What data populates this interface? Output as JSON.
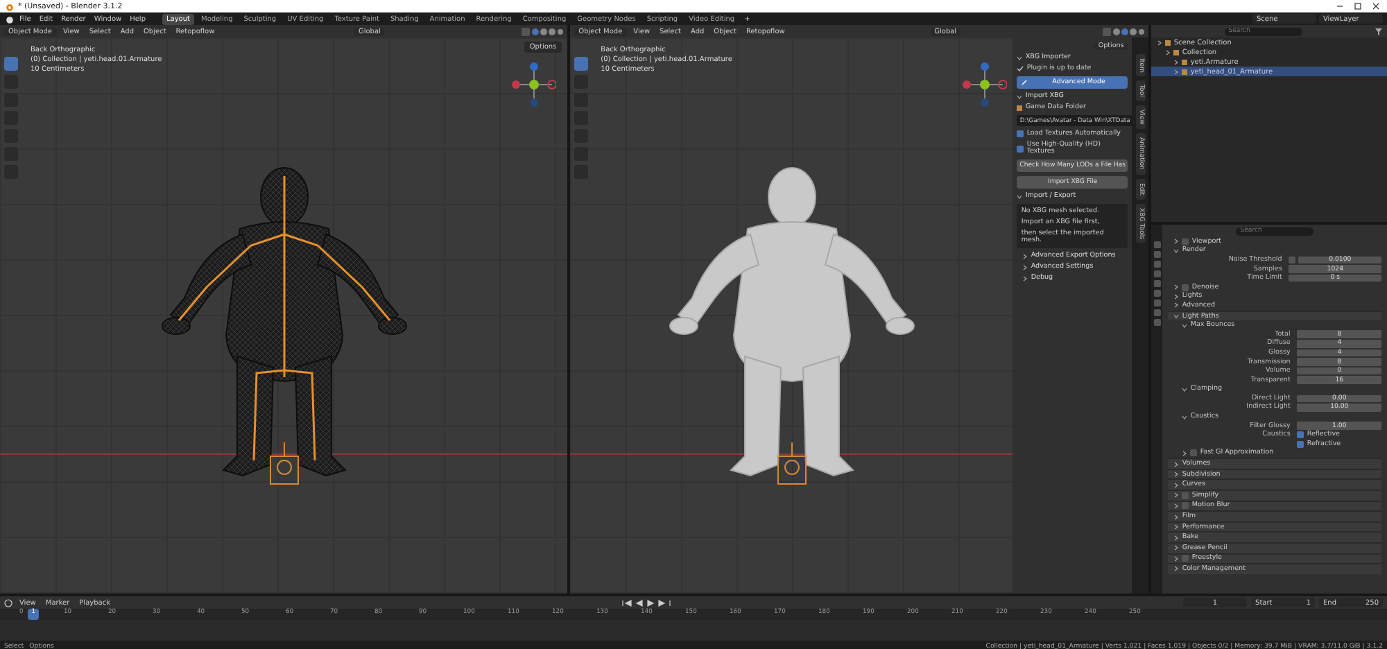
{
  "window": {
    "title": "* (Unsaved) - Blender 3.1.2"
  },
  "menu": [
    "File",
    "Edit",
    "Render",
    "Window",
    "Help"
  ],
  "workspaces": [
    {
      "label": "Layout",
      "selected": true
    },
    {
      "label": "Modeling",
      "selected": false
    },
    {
      "label": "Sculpting",
      "selected": false
    },
    {
      "label": "UV Editing",
      "selected": false
    },
    {
      "label": "Texture Paint",
      "selected": false
    },
    {
      "label": "Shading",
      "selected": false
    },
    {
      "label": "Animation",
      "selected": false
    },
    {
      "label": "Rendering",
      "selected": false
    },
    {
      "label": "Compositing",
      "selected": false
    },
    {
      "label": "Geometry Nodes",
      "selected": false
    },
    {
      "label": "Scripting",
      "selected": false
    },
    {
      "label": "Video Editing",
      "selected": false
    }
  ],
  "add_workspace": "+",
  "scene": "Scene",
  "view_layer": "ViewLayer",
  "viewports": [
    {
      "mode": "Object Mode",
      "menus": [
        "View",
        "Select",
        "Add",
        "Object",
        "Retopoflow"
      ],
      "orientation": "Global",
      "options": "Options",
      "overlay": [
        "Back Orthographic",
        "(0) Collection | yeti.head.01.Armature",
        "10 Centimeters"
      ],
      "kind": "wireframe"
    },
    {
      "mode": "Object Mode",
      "menus": [
        "View",
        "Select",
        "Add",
        "Object",
        "Retopoflow"
      ],
      "orientation": "Global",
      "options": "Options",
      "overlay": [
        "Back Orthographic",
        "(0) Collection | yeti.head.01.Armature",
        "10 Centimeters"
      ],
      "kind": "solid"
    }
  ],
  "n_panel": {
    "title": "XBG Importer",
    "items": [
      {
        "kind": "status",
        "text": "Plugin is up to date"
      },
      {
        "kind": "primary",
        "text": "Advanced Mode"
      },
      {
        "kind": "section",
        "text": "Import XBG"
      },
      {
        "kind": "label",
        "text": "Game Data Folder"
      },
      {
        "kind": "path",
        "text": "D:\\Games\\Avatar - Data Win\\XTData"
      },
      {
        "kind": "checkbox",
        "text": "Load Textures Automatically",
        "checked": true
      },
      {
        "kind": "checkbox",
        "text": "Use High-Quality (HD) Textures",
        "checked": true
      },
      {
        "kind": "button",
        "text": "Check How Many LODs a File Has"
      },
      {
        "kind": "button",
        "text": "Import XBG File"
      },
      {
        "kind": "section",
        "text": "Import / Export"
      },
      {
        "kind": "info",
        "lines": [
          "No XBG mesh selected.",
          "Import an XBG file first,",
          "then select the imported mesh."
        ]
      },
      {
        "kind": "collapsed",
        "text": "Advanced Export Options"
      },
      {
        "kind": "collapsed",
        "text": "Advanced Settings"
      },
      {
        "kind": "collapsed",
        "text": "Debug"
      }
    ],
    "tabs": [
      "Item",
      "Tool",
      "View",
      "Animation",
      "Edit",
      "XBG Tools"
    ]
  },
  "outliner": {
    "search": {
      "placeholder": "Search"
    },
    "tree": [
      {
        "label": "Scene Collection",
        "selected": false,
        "children": [
          {
            "label": "Collection",
            "selected": false,
            "children": [
              {
                "label": "yeti.Armature",
                "selected": false
              },
              {
                "label": "yeti_head_01_Armature",
                "selected": true
              }
            ]
          }
        ]
      }
    ]
  },
  "properties": {
    "search": {
      "placeholder": "Search"
    },
    "panels": [
      {
        "kind": "panel",
        "title": "Viewport",
        "expanded": false,
        "checked": false
      },
      {
        "kind": "panel",
        "title": "Render",
        "expanded": true,
        "children": [
          {
            "kind": "field",
            "label": "Noise Threshold",
            "value": "0.0100",
            "checked": false
          },
          {
            "kind": "field",
            "label": "Samples",
            "value": "1024"
          },
          {
            "kind": "field",
            "label": "Time Limit",
            "value": "0 s"
          }
        ]
      },
      {
        "kind": "panel",
        "title": "Denoise",
        "expanded": false,
        "checked": false
      },
      {
        "kind": "panel",
        "title": "Lights",
        "expanded": false
      },
      {
        "kind": "panel",
        "title": "Advanced",
        "expanded": false
      },
      {
        "kind": "top",
        "title": "Light Paths",
        "expanded": true,
        "children": [
          {
            "kind": "panel",
            "title": "Max Bounces",
            "expanded": true,
            "children": [
              {
                "kind": "field",
                "label": "Total",
                "value": "8"
              },
              {
                "kind": "field",
                "label": "Diffuse",
                "value": "4"
              },
              {
                "kind": "field",
                "label": "Glossy",
                "value": "4"
              },
              {
                "kind": "field",
                "label": "Transmission",
                "value": "8"
              },
              {
                "kind": "field",
                "label": "Volume",
                "value": "0"
              },
              {
                "kind": "field",
                "label": "Transparent",
                "value": "16"
              }
            ]
          },
          {
            "kind": "panel",
            "title": "Clamping",
            "expanded": true,
            "children": [
              {
                "kind": "field",
                "label": "Direct Light",
                "value": "0.00"
              },
              {
                "kind": "field",
                "label": "Indirect Light",
                "value": "10.00"
              }
            ]
          },
          {
            "kind": "panel",
            "title": "Caustics",
            "expanded": true,
            "children": [
              {
                "kind": "field",
                "label": "Filter Glossy",
                "value": "1.00"
              },
              {
                "kind": "check",
                "label": "Caustics",
                "text": "Reflective",
                "checked": true
              },
              {
                "kind": "check",
                "text": "Refractive",
                "checked": true
              }
            ]
          },
          {
            "kind": "panel",
            "title": "Fast GI Approximation",
            "expanded": false,
            "checked": false
          }
        ]
      },
      {
        "kind": "top",
        "title": "Volumes",
        "expanded": false
      },
      {
        "kind": "top",
        "title": "Subdivision",
        "expanded": false
      },
      {
        "kind": "top",
        "title": "Curves",
        "expanded": false
      },
      {
        "kind": "top",
        "title": "Simplify",
        "expanded": false,
        "checked": false
      },
      {
        "kind": "top",
        "title": "Motion Blur",
        "expanded": false,
        "checked": false
      },
      {
        "kind": "top",
        "title": "Film",
        "expanded": false
      },
      {
        "kind": "top",
        "title": "Performance",
        "expanded": false
      },
      {
        "kind": "top",
        "title": "Bake",
        "expanded": false
      },
      {
        "kind": "top",
        "title": "Grease Pencil",
        "expanded": false
      },
      {
        "kind": "top",
        "title": "Freestyle",
        "expanded": false,
        "checked": false
      },
      {
        "kind": "top",
        "title": "Color Management",
        "expanded": false
      }
    ]
  },
  "timeline": {
    "menus": [
      "View",
      "Marker",
      "Playback"
    ],
    "current_frame": "1",
    "start_label": "Start",
    "start": "1",
    "end_label": "End",
    "end": "250",
    "ruler": [
      "0",
      "10",
      "20",
      "30",
      "40",
      "50",
      "60",
      "70",
      "80",
      "90",
      "100",
      "110",
      "120",
      "130",
      "140",
      "150",
      "160",
      "170",
      "180",
      "190",
      "200",
      "210",
      "220",
      "230",
      "240",
      "250"
    ],
    "playhead": "1"
  },
  "status_bar": {
    "left": [
      "Select",
      "Options"
    ],
    "right": "Collection | yeti_head_01_Armature | Verts 1,021 | Faces 1,019 | Objects 0/2 | Memory: 39.7 MiB | VRAM: 3.7/11.0 GiB | 3.1.2"
  }
}
